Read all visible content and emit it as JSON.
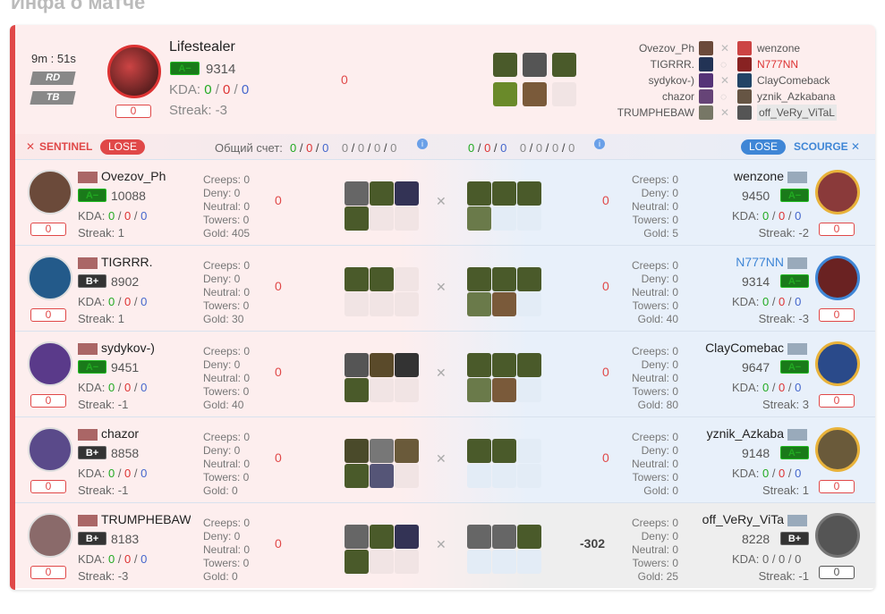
{
  "title": "Инфа о матче",
  "header": {
    "time": "9m : 51s",
    "mode1": "RD",
    "mode2": "TB",
    "hero": "Lifestealer",
    "rank": "A−",
    "mmr": "9314",
    "kda_label": "KDA:",
    "k": "0",
    "d": "0",
    "a": "0",
    "streak": "Streak: -3",
    "badge": "0",
    "center_score": "0"
  },
  "matchup": [
    {
      "left": "Ovezov_Ph",
      "right": "wenzone"
    },
    {
      "left": "TIGRRR.",
      "right": "N777NN"
    },
    {
      "left": "sydykov-)",
      "right": "ClayComeback"
    },
    {
      "left": "chazor",
      "right": "yznik_Azkabana"
    },
    {
      "left": "TRUMPHEBAW",
      "right": "off_VeRy_ViTaL"
    }
  ],
  "scorebar": {
    "sentinel": "SENTINEL",
    "lose": "LOSE",
    "total_label": "Общий счет:",
    "l1": "0",
    "l2": "0",
    "l3": "0",
    "l4": "0",
    "l5": "0",
    "l6": "0",
    "l7": "0",
    "r1": "0",
    "r2": "0",
    "r3": "0",
    "r4": "0",
    "r5": "0",
    "r6": "0",
    "r7": "0",
    "lose_r": "LOSE",
    "scourge": "SCOURGE"
  },
  "rows": [
    {
      "ln": "Ovezov_Ph",
      "lr": "A−",
      "lm": "10088",
      "lk": "0",
      "ld": "0",
      "la": "0",
      "ls": "Streak: 1",
      "lc": "Creeps: 0",
      "ldn": "Deny: 0",
      "lne": "Neutral: 0",
      "lt": "Towers: 0",
      "lg": "Gold: 405",
      "lz": "0",
      "rn": "wenzone",
      "rr": "A−",
      "rm": "9450",
      "rk": "0",
      "rd": "0",
      "ra": "0",
      "rs": "Streak: -2",
      "rc": "Creeps: 0",
      "rdn": "Deny: 0",
      "rne": "Neutral: 0",
      "rt": "Towers: 0",
      "rg": "Gold: 5",
      "rz": "0"
    },
    {
      "ln": "TIGRRR.",
      "lr": "B+",
      "lm": "8902",
      "lk": "0",
      "ld": "0",
      "la": "0",
      "ls": "Streak: 1",
      "lc": "Creeps: 0",
      "ldn": "Deny: 0",
      "lne": "Neutral: 0",
      "lt": "Towers: 0",
      "lg": "Gold: 30",
      "lz": "0",
      "rn": "N777NN",
      "rr": "A−",
      "rm": "9314",
      "rk": "0",
      "rd": "0",
      "ra": "0",
      "rs": "Streak: -3",
      "rc": "Creeps: 0",
      "rdn": "Deny: 0",
      "rne": "Neutral: 0",
      "rt": "Towers: 0",
      "rg": "Gold: 40",
      "rz": "0"
    },
    {
      "ln": "sydykov-)",
      "lr": "A−",
      "lm": "9451",
      "lk": "0",
      "ld": "0",
      "la": "0",
      "ls": "Streak: -1",
      "lc": "Creeps: 0",
      "ldn": "Deny: 0",
      "lne": "Neutral: 0",
      "lt": "Towers: 0",
      "lg": "Gold: 40",
      "lz": "0",
      "rn": "ClayComebac",
      "rr": "A−",
      "rm": "9647",
      "rk": "0",
      "rd": "0",
      "ra": "0",
      "rs": "Streak: 3",
      "rc": "Creeps: 0",
      "rdn": "Deny: 0",
      "rne": "Neutral: 0",
      "rt": "Towers: 0",
      "rg": "Gold: 80",
      "rz": "0"
    },
    {
      "ln": "chazor",
      "lr": "B+",
      "lm": "8858",
      "lk": "0",
      "ld": "0",
      "la": "0",
      "ls": "Streak: -1",
      "lc": "Creeps: 0",
      "ldn": "Deny: 0",
      "lne": "Neutral: 0",
      "lt": "Towers: 0",
      "lg": "Gold: 0",
      "lz": "0",
      "rn": "yznik_Azkaba",
      "rr": "A−",
      "rm": "9148",
      "rk": "0",
      "rd": "0",
      "ra": "0",
      "rs": "Streak: 1",
      "rc": "Creeps: 0",
      "rdn": "Deny: 0",
      "rne": "Neutral: 0",
      "rt": "Towers: 0",
      "rg": "Gold: 0",
      "rz": "0"
    },
    {
      "ln": "TRUMPHEBAW",
      "lr": "B+",
      "lm": "8183",
      "lk": "0",
      "ld": "0",
      "la": "0",
      "ls": "Streak: -3",
      "lc": "Creeps: 0",
      "ldn": "Deny: 0",
      "lne": "Neutral: 0",
      "lt": "Towers: 0",
      "lg": "Gold: 0",
      "lz": "0",
      "rn": "off_VeRy_ViTa",
      "rr": "B+",
      "rm": "8228",
      "rk": "0",
      "rd": "0",
      "ra": "0",
      "rs": "Streak: -1",
      "rc": "Creeps: 0",
      "rdn": "Deny: 0",
      "rne": "Neutral: 0",
      "rt": "Towers: 0",
      "rg": "Gold: 25",
      "rz": "-302"
    }
  ]
}
